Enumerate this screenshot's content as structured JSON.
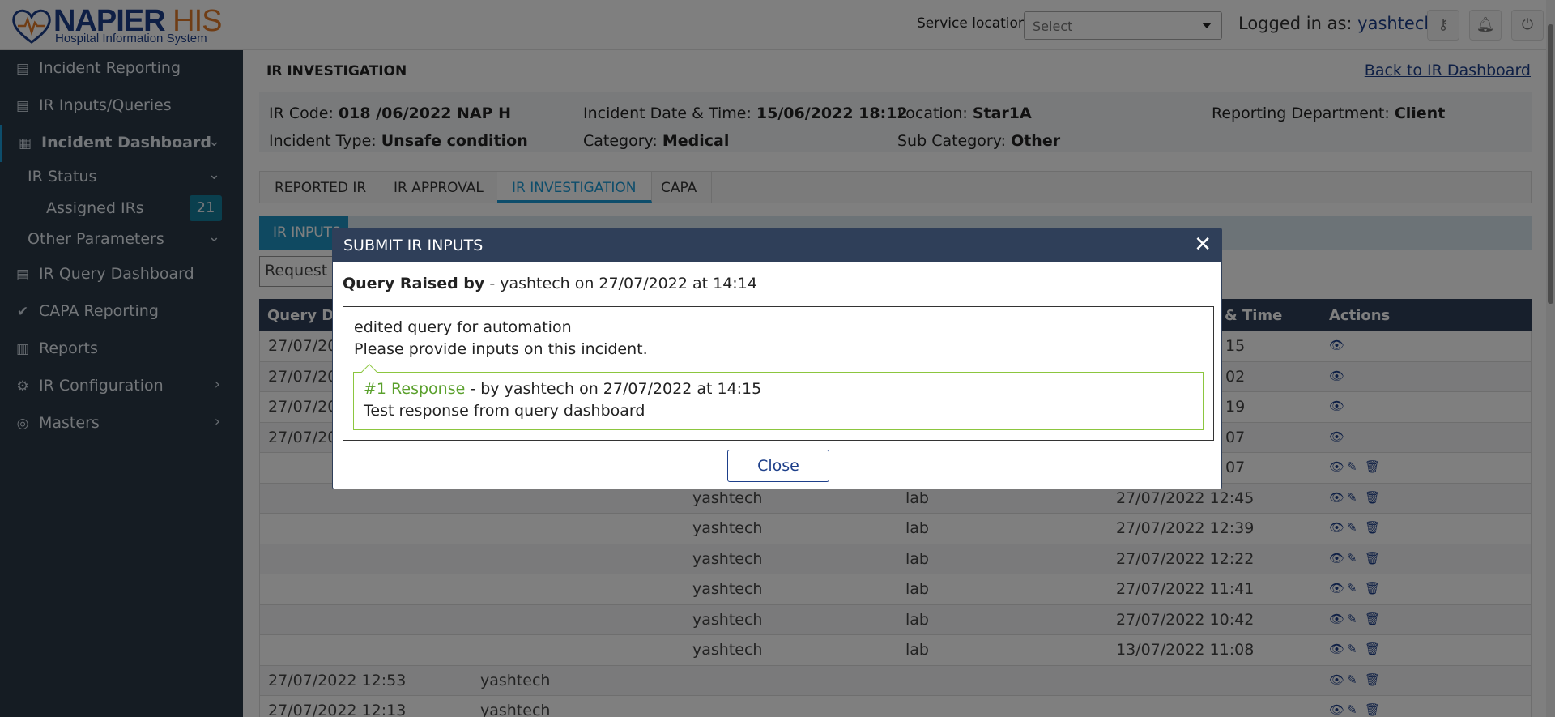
{
  "header": {
    "logo_name": "NAPIER",
    "logo_his": "HIS",
    "logo_sub": "Hospital Information System",
    "service_location_label": "Service location",
    "service_location_value": "Select",
    "logged_in_label": "Logged in as:",
    "logged_in_user": "yashtech",
    "icons": [
      "key-icon",
      "bell-icon",
      "power-icon"
    ]
  },
  "sidebar": {
    "items": [
      {
        "label": "Incident Reporting",
        "icon": "report-icon"
      },
      {
        "label": "IR Inputs/Queries",
        "icon": "inputs-icon"
      },
      {
        "label": "Incident Dashboard",
        "icon": "dashboard-icon",
        "active": true
      },
      {
        "label": "IR Status"
      },
      {
        "label": "Assigned IRs",
        "badge": "21"
      },
      {
        "label": "Other Parameters"
      },
      {
        "label": "IR Query Dashboard",
        "icon": "query-icon"
      },
      {
        "label": "CAPA Reporting",
        "icon": "check-circle-icon"
      },
      {
        "label": "Reports",
        "icon": "chart-icon"
      },
      {
        "label": "IR Configuration",
        "icon": "gear-icon"
      },
      {
        "label": "Masters",
        "icon": "masters-icon"
      }
    ]
  },
  "main": {
    "title": "IR INVESTIGATION",
    "back_link": "Back to IR Dashboard",
    "info": {
      "ir_code_label": "IR Code:",
      "ir_code": "018 /06/2022 NAP H",
      "incident_dt_label": "Incident Date & Time:",
      "incident_dt": "15/06/2022 18:12",
      "location_label": "Location:",
      "location": "Star1A",
      "reporting_dept_label": "Reporting Department:",
      "reporting_dept": "Client",
      "incident_type_label": "Incident Type:",
      "incident_type": "Unsafe condition",
      "category_label": "Category:",
      "category": "Medical",
      "sub_category_label": "Sub Category:",
      "sub_category": "Other"
    },
    "tabs": [
      "REPORTED IR",
      "IR APPROVAL",
      "IR INVESTIGATION",
      "CAPA"
    ],
    "subtab": "IR INPUTS",
    "request_box": "Request I",
    "table": {
      "headers": [
        "Query Da",
        "& Time",
        "Actions"
      ],
      "rows": [
        {
          "date": "27/07/20",
          "user": "",
          "dept": "",
          "time": "15",
          "actions": "view"
        },
        {
          "date": "27/07/20",
          "user": "",
          "dept": "",
          "time": "02",
          "actions": "view"
        },
        {
          "date": "27/07/20",
          "user": "",
          "dept": "",
          "time": "19",
          "actions": "view"
        },
        {
          "date": "27/07/20",
          "user": "",
          "dept": "",
          "time": "07",
          "actions": "view"
        },
        {
          "date": "",
          "user": "",
          "dept": "",
          "time": "07",
          "actions": "all"
        },
        {
          "date": "",
          "user": "yashtech",
          "dept": "lab",
          "time": "27/07/2022 12:45",
          "actions": "all"
        },
        {
          "date": "",
          "user": "yashtech",
          "dept": "lab",
          "time": "27/07/2022 12:39",
          "actions": "all"
        },
        {
          "date": "",
          "user": "yashtech",
          "dept": "lab",
          "time": "27/07/2022 12:22",
          "actions": "all"
        },
        {
          "date": "",
          "user": "yashtech",
          "dept": "lab",
          "time": "27/07/2022 11:41",
          "actions": "all"
        },
        {
          "date": "",
          "user": "yashtech",
          "dept": "lab",
          "time": "27/07/2022 10:42",
          "actions": "all"
        },
        {
          "date": "",
          "user": "yashtech",
          "dept": "lab",
          "time": "13/07/2022 11:08",
          "actions": "all"
        },
        {
          "date": "27/07/2022 12:53",
          "user": "yashtech",
          "dept": "",
          "time": "",
          "actions": "all"
        },
        {
          "date": "27/07/2022 12:13",
          "user": "yashtech",
          "dept": "",
          "time": "",
          "actions": "all"
        }
      ]
    }
  },
  "modal": {
    "title": "SUBMIT IR INPUTS",
    "raised_label": "Query Raised by",
    "raised_detail": " - yashtech on 27/07/2022 at 14:14",
    "query_line1": "edited query for automation",
    "query_line2": "Please provide inputs on this incident.",
    "response_num": "#1 Response",
    "response_by": " - by yashtech on 27/07/2022 at 14:15",
    "response_text": "Test response from query dashboard",
    "close_label": "Close"
  }
}
